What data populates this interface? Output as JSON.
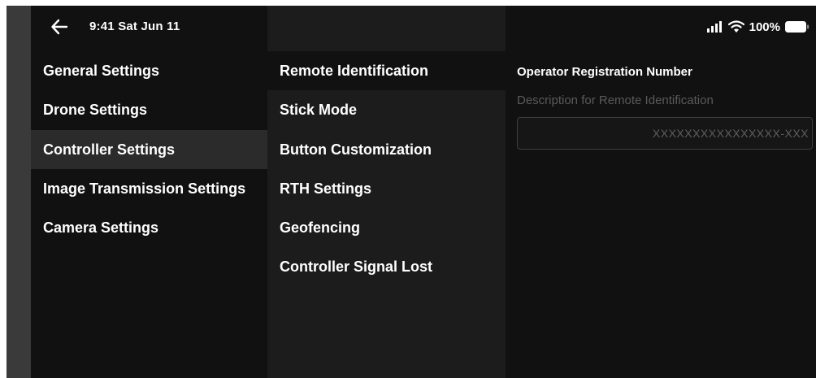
{
  "status_bar": {
    "time_date": "9:41  Sat Jun 11",
    "battery_percent": "100%",
    "icons": [
      "back-arrow-icon",
      "signal-icon",
      "wifi-icon",
      "battery-icon"
    ]
  },
  "categories": [
    {
      "label": "General Settings",
      "selected": false
    },
    {
      "label": "Drone Settings",
      "selected": false
    },
    {
      "label": "Controller Settings",
      "selected": true
    },
    {
      "label": "Image Transmission Settings",
      "selected": false
    },
    {
      "label": "Camera Settings",
      "selected": false
    }
  ],
  "subitems": [
    {
      "label": "Remote Identification",
      "selected": true
    },
    {
      "label": "Stick Mode",
      "selected": false
    },
    {
      "label": "Button Customization",
      "selected": false
    },
    {
      "label": "RTH Settings",
      "selected": false
    },
    {
      "label": "Geofencing",
      "selected": false
    },
    {
      "label": "Controller Signal Lost",
      "selected": false
    }
  ],
  "detail": {
    "title": "Operator Registration Number",
    "description": "Description for Remote Identification",
    "input_value": "",
    "input_placeholder": "XXXXXXXXXXXXXXXX-XXX"
  },
  "colors": {
    "background": "#111111",
    "selected_row": "#2b2b2b",
    "middle_panel": "#1c1c1c",
    "muted_text": "#5a5a5a"
  }
}
